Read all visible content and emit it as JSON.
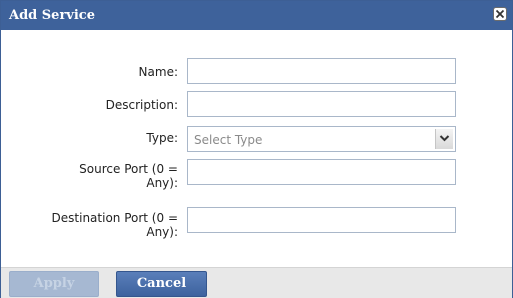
{
  "dialog": {
    "title": "Add Service",
    "close_icon": "close-icon"
  },
  "form": {
    "name_label": "Name:",
    "name_value": "",
    "description_label": "Description:",
    "description_value": "",
    "type_label": "Type:",
    "type_selected": "Select Type",
    "type_dropdown_icon": "chevron-down-icon",
    "source_port_label_line1": "Source Port (0 =",
    "source_port_label_line2": "Any):",
    "source_port_value": "",
    "destination_port_label_line1": "Destination Port (0 =",
    "destination_port_label_line2": "Any):",
    "destination_port_value": ""
  },
  "footer": {
    "apply_label": "Apply",
    "apply_enabled": false,
    "cancel_label": "Cancel"
  },
  "colors": {
    "titlebar": "#3e629b",
    "button_primary": "#4a6fab",
    "button_disabled": "#a6b8d2",
    "footer_bg": "#e8e8e8"
  }
}
